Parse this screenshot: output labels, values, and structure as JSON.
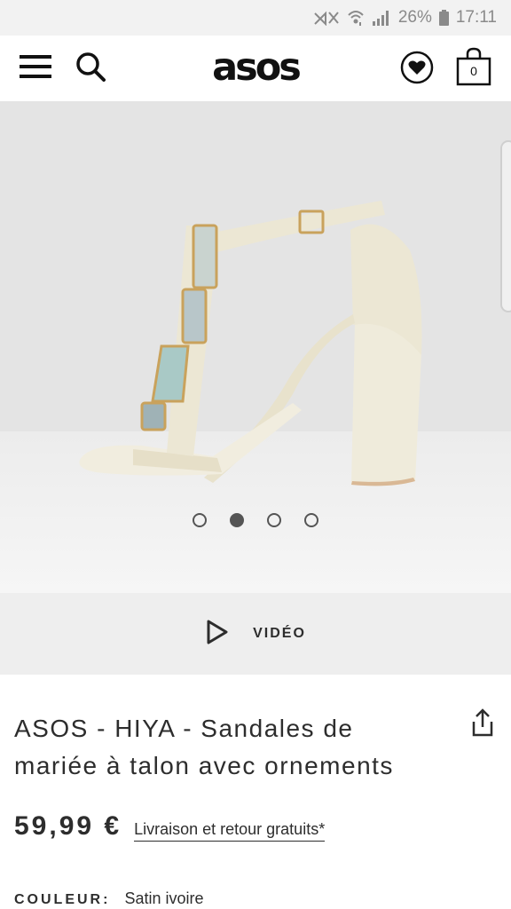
{
  "status_bar": {
    "battery": "26%",
    "time": "17:11",
    "icons": [
      "mute-icon",
      "wifi-icon",
      "signal-icon",
      "battery-icon"
    ]
  },
  "header": {
    "logo": "asos",
    "icons": [
      "menu-icon",
      "search-icon",
      "heart-icon",
      "bag-icon"
    ],
    "bag_count": "0"
  },
  "gallery": {
    "image": "product-image-shoe",
    "slides": 4,
    "active_slide": 2
  },
  "video": {
    "label": "VIDÉO",
    "icon": "play-icon"
  },
  "product": {
    "title": "ASOS - HIYA - Sandales de mariée à talon avec ornements",
    "price": "59,99 €",
    "delivery": "Livraison et retour gratuits*",
    "colour_label": "COULEUR:",
    "colour_value": "Satin ivoire",
    "share_icon": "share-icon"
  },
  "colors": {
    "statusbar": "#f2f2f2",
    "hero_bg": "#e4e4e4",
    "videobar": "#eeeeee",
    "text": "#2d2d2d",
    "shoe": "#f0ecdd"
  }
}
